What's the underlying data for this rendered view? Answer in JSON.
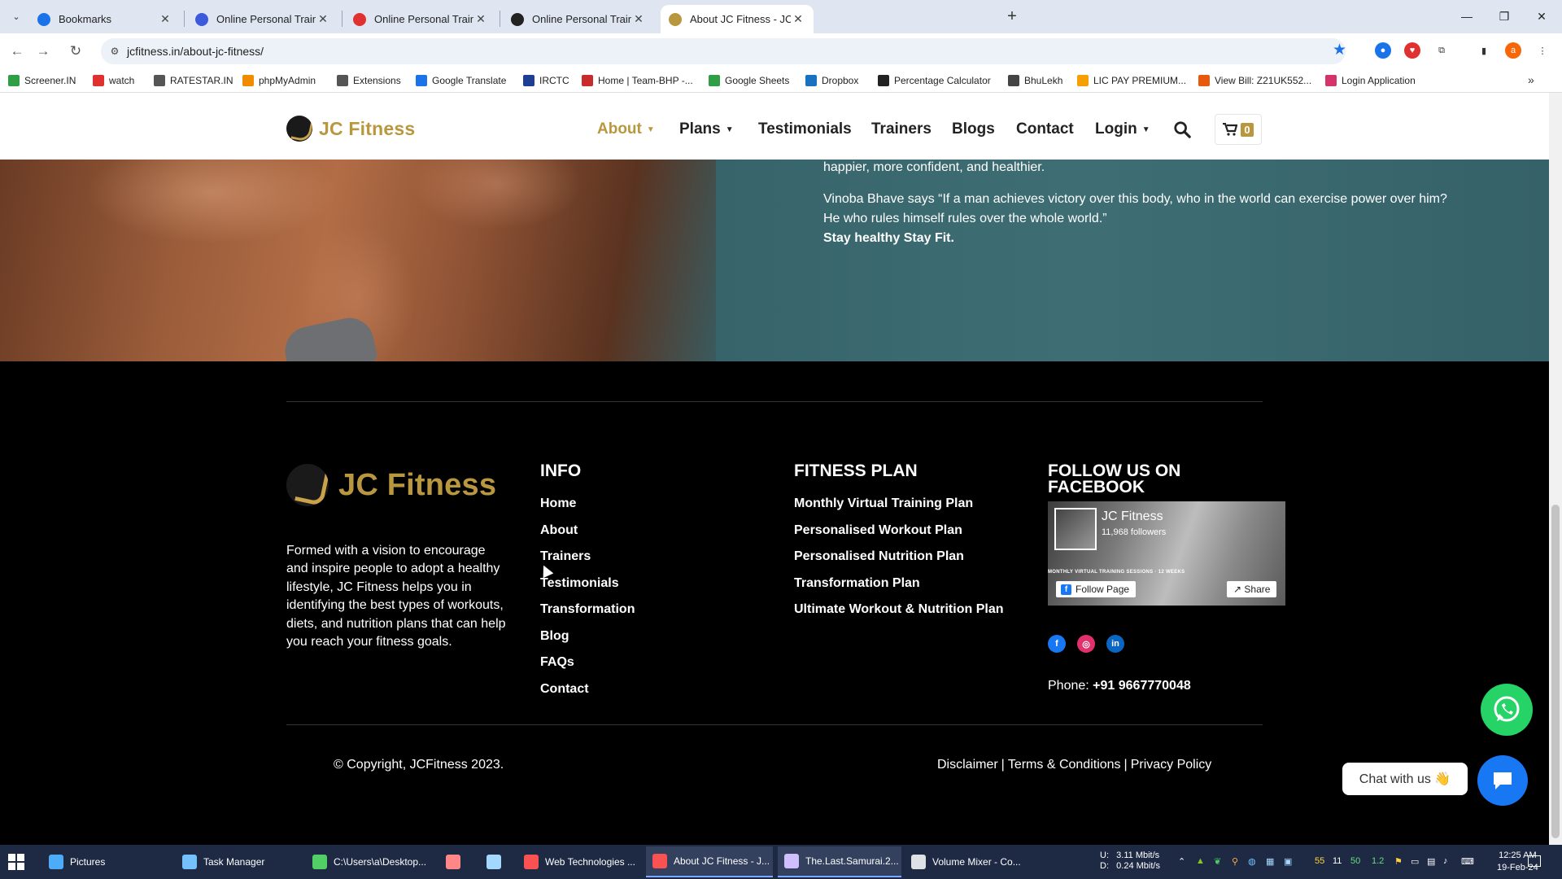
{
  "browser": {
    "tabs": [
      {
        "title": "Bookmarks",
        "icon": "star-icon",
        "icon_color": "#1a73e8",
        "active": false
      },
      {
        "title": "Online Personal Trainer and Fitr",
        "icon": "globe-icon",
        "icon_color": "#3b5bdb",
        "active": false
      },
      {
        "title": "Online Personal Trainer and Onl",
        "icon": "target-icon",
        "icon_color": "#e03131",
        "active": false
      },
      {
        "title": "Online Personal Trainer | Sarah",
        "icon": "sarah-icon",
        "icon_color": "#222222",
        "active": false
      },
      {
        "title": "About JC Fitness - JC Fitness",
        "icon": "jc-fitness-icon",
        "icon_color": "#b9973f",
        "active": true
      }
    ],
    "new_tab": "+",
    "url": "jcfitness.in/about-jc-fitness/",
    "profile_initial": "a",
    "bookmarks": [
      {
        "label": "Screener.IN",
        "color": "#2f9e44"
      },
      {
        "label": "watch",
        "color": "#e03131"
      },
      {
        "label": "RATESTAR.IN",
        "color": "#555555"
      },
      {
        "label": "phpMyAdmin",
        "color": "#f08c00"
      },
      {
        "label": "Extensions",
        "color": "#555555"
      },
      {
        "label": "Google Translate",
        "color": "#1a73e8"
      },
      {
        "label": "IRCTC",
        "color": "#1c3f95"
      },
      {
        "label": "Home | Team-BHP -...",
        "color": "#c92a2a"
      },
      {
        "label": "Google Sheets",
        "color": "#2f9e44"
      },
      {
        "label": "Dropbox",
        "color": "#1971c2"
      },
      {
        "label": "Percentage Calculator",
        "color": "#222222"
      },
      {
        "label": "BhuLekh",
        "color": "#444444"
      },
      {
        "label": "LIC PAY PREMIUM...",
        "color": "#f59f00"
      },
      {
        "label": "View Bill: Z21UK552...",
        "color": "#e8590c"
      },
      {
        "label": "Login Application",
        "color": "#d6336c"
      }
    ]
  },
  "site": {
    "logo_text": "JC Fitness",
    "nav": [
      {
        "label": "About",
        "has_dropdown": true,
        "active": true
      },
      {
        "label": "Plans",
        "has_dropdown": true,
        "active": false
      },
      {
        "label": "Testimonials",
        "has_dropdown": false,
        "active": false
      },
      {
        "label": "Trainers",
        "has_dropdown": false,
        "active": false
      },
      {
        "label": "Blogs",
        "has_dropdown": false,
        "active": false
      },
      {
        "label": "Contact",
        "has_dropdown": false,
        "active": false
      },
      {
        "label": "Login",
        "has_dropdown": true,
        "active": false
      }
    ],
    "cart_count": "0",
    "accent_color": "#b9973f"
  },
  "hero": {
    "line1": "happier, more confident, and healthier.",
    "quote_line1": "Vinoba Bhave says “If a man achieves victory over this body, who in the world can exercise power over him?",
    "quote_line2": "He who rules himself  rules over the whole world.”",
    "tagline": "Stay healthy Stay Fit."
  },
  "footer": {
    "logo_text": "JC Fitness",
    "about": "Formed with a vision to encourage and inspire people to adopt a healthy lifestyle, JC Fitness helps you in identifying the best types of workouts, diets, and nutrition plans that can help you reach your fitness goals.",
    "info_title": "INFO",
    "info_links": [
      "Home",
      "About",
      "Trainers",
      "Testimonials",
      "Transformation",
      "Blog",
      "FAQs",
      "Contact"
    ],
    "plan_title": "FITNESS PLAN",
    "plan_links": [
      "Monthly Virtual Training Plan",
      "Personalised Workout Plan",
      "Personalised Nutrition Plan",
      "Transformation Plan",
      "Ultimate Workout & Nutrition Plan"
    ],
    "follow_title_line1": "FOLLOW US ON",
    "follow_title_line2": "FACEBOOK",
    "fb_page": {
      "name": "JC Fitness",
      "followers": "11,968 followers",
      "follow_label": "Follow Page",
      "share_label": "Share",
      "banner": "MONTHLY VIRTUAL TRAINING SESSIONS · 12 WEEKS"
    },
    "socials": [
      {
        "name": "facebook-icon",
        "glyph": "f",
        "color": "#1877f2"
      },
      {
        "name": "instagram-icon",
        "glyph": "◎",
        "color": "#e1306c"
      },
      {
        "name": "linkedin-icon",
        "glyph": "in",
        "color": "#0a66c2"
      }
    ],
    "phone_label": "Phone:",
    "phone_number": "+91 9667770048",
    "copyright": "© Copyright, JCFitness 2023.",
    "legal": [
      "Disclaimer",
      "Terms & Conditions",
      "Privacy Policy"
    ],
    "legal_sep": "|"
  },
  "widgets": {
    "chat_label": "Chat with us 👋"
  },
  "taskbar": {
    "items": [
      {
        "label": "Pictures",
        "color": "#4dabf7",
        "active": false
      },
      {
        "label": "Task Manager",
        "color": "#74c0fc",
        "active": false
      },
      {
        "label": "C:\\Users\\a\\Desktop...",
        "color": "#51cf66",
        "active": false
      },
      {
        "label": "",
        "color": "#ff8787",
        "active": false
      },
      {
        "label": "",
        "color": "#a5d8ff",
        "active": false
      },
      {
        "label": "Web Technologies ...",
        "color": "#fa5252",
        "active": false
      },
      {
        "label": "About JC Fitness - J...",
        "color": "#fa5252",
        "active": true
      },
      {
        "label": "The.Last.Samurai.2...",
        "color": "#d0bfff",
        "active": true
      },
      {
        "label": "Volume Mixer - Co...",
        "color": "#dee2e6",
        "active": false
      }
    ],
    "net_up": "U:",
    "net_up_val": "3.11 Mbit/s",
    "net_down": "D:",
    "net_down_val": "0.24 Mbit/s",
    "tray_numbers": [
      "55",
      "11",
      "50",
      "1.2"
    ],
    "time": "12:25 AM",
    "date": "19-Feb-24"
  }
}
